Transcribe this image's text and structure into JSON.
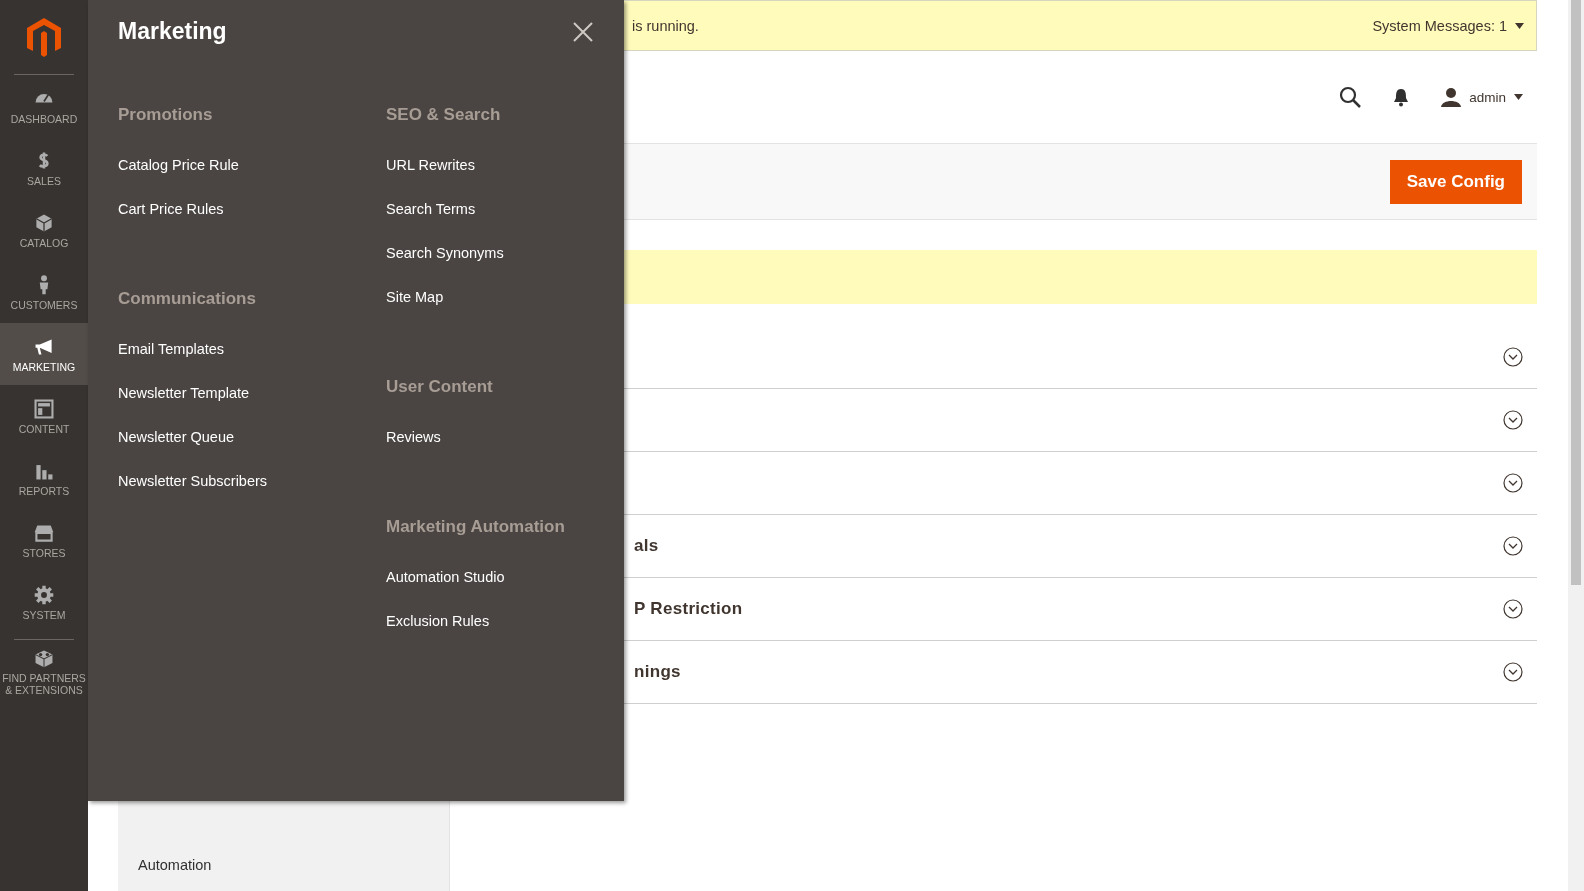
{
  "system_message": {
    "text": "is running.",
    "label": "System Messages: 1"
  },
  "header": {
    "user": "admin"
  },
  "actions": {
    "save": "Save Config"
  },
  "sidebar": {
    "items": [
      {
        "label": "DASHBOARD",
        "selected": false
      },
      {
        "label": "SALES",
        "selected": false
      },
      {
        "label": "CATALOG",
        "selected": false
      },
      {
        "label": "CUSTOMERS",
        "selected": false
      },
      {
        "label": "MARKETING",
        "selected": true
      },
      {
        "label": "CONTENT",
        "selected": false
      },
      {
        "label": "REPORTS",
        "selected": false
      },
      {
        "label": "STORES",
        "selected": false
      },
      {
        "label": "SYSTEM",
        "selected": false
      },
      {
        "label": "FIND PARTNERS & EXTENSIONS",
        "selected": false
      }
    ]
  },
  "flyout": {
    "title": "Marketing",
    "columns": [
      [
        {
          "heading": "Promotions",
          "links": [
            "Catalog Price Rule",
            "Cart Price Rules"
          ]
        },
        {
          "heading": "Communications",
          "links": [
            "Email Templates",
            "Newsletter Template",
            "Newsletter Queue",
            "Newsletter Subscribers"
          ]
        }
      ],
      [
        {
          "heading": "SEO & Search",
          "links": [
            "URL Rewrites",
            "Search Terms",
            "Search Synonyms",
            "Site Map"
          ]
        },
        {
          "heading": "User Content",
          "links": [
            "Reviews"
          ]
        },
        {
          "heading": "Marketing Automation",
          "links": [
            "Automation Studio",
            "Exclusion Rules"
          ]
        }
      ]
    ]
  },
  "sections": [
    {
      "expanded": false
    },
    {
      "expanded": false
    },
    {
      "expanded": false
    },
    {
      "title": "als",
      "expanded": false
    },
    {
      "title": "P Restriction",
      "expanded": false
    },
    {
      "title": "nings",
      "expanded": false
    }
  ],
  "config_nav": {
    "items": [
      "Automation"
    ]
  }
}
